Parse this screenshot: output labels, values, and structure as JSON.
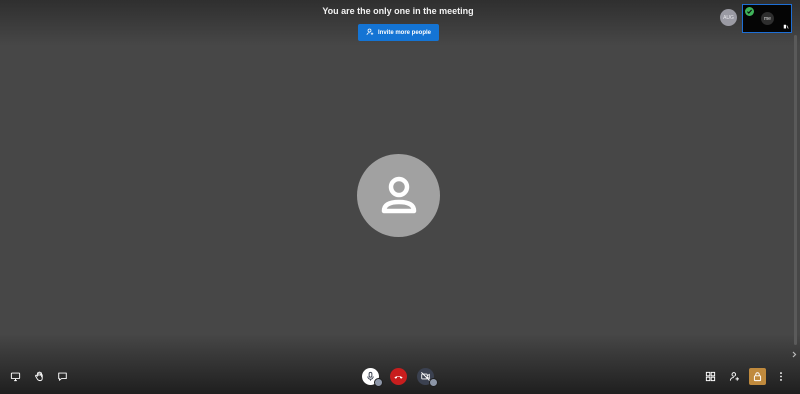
{
  "meeting": {
    "notice": "You are the only one in the meeting",
    "invite_label": "Invite more people"
  },
  "participants": {
    "small_avatar_initials": "AUG",
    "self_label": "me"
  },
  "colors": {
    "background": "#474747",
    "invite": "#1474d4",
    "end_call": "#c81e1e",
    "lock": "#c08a3d",
    "status_ok": "#3fb35a"
  },
  "toolbar": {
    "left": [
      "share-screen-icon",
      "raise-hand-icon",
      "chat-icon"
    ],
    "center": [
      "microphone-icon",
      "hangup-icon",
      "camera-off-icon"
    ],
    "right": [
      "tile-view-icon",
      "invite-people-icon",
      "security-lock-icon",
      "more-options-icon"
    ]
  }
}
